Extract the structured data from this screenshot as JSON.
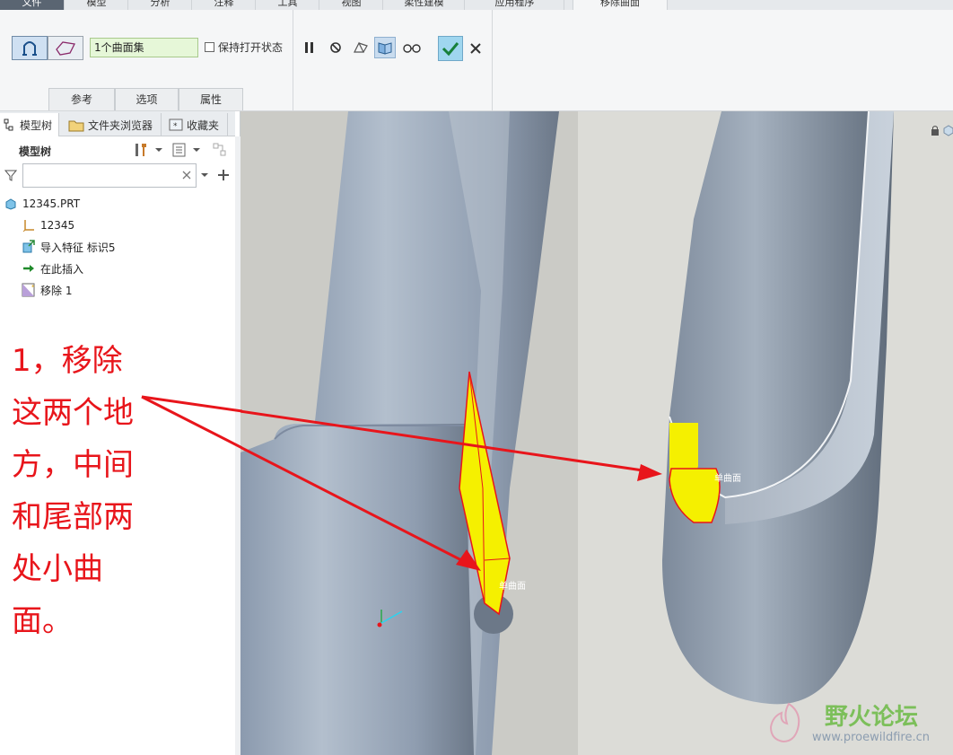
{
  "ribbon": {
    "tabs": [
      "文件",
      "模型",
      "分析",
      "注释",
      "工具",
      "视图",
      "柔性建模",
      "应用程序",
      "移除曲面"
    ],
    "active_tab": "移除曲面"
  },
  "dashboard": {
    "collector_value": "1个曲面集",
    "keep_open_label": "保持打开状态",
    "keep_open_checked": false,
    "tabs": [
      "参考",
      "选项",
      "属性"
    ]
  },
  "navigator": {
    "tabs": [
      "模型树",
      "文件夹浏览器",
      "收藏夹"
    ],
    "tree_title": "模型树",
    "search_placeholder": "",
    "tree_items": [
      {
        "label": "12345.PRT",
        "icon": "part-icon"
      },
      {
        "label": "12345",
        "icon": "csys-icon"
      },
      {
        "label": "导入特征 标识5",
        "icon": "import-feature-icon"
      },
      {
        "label": "在此插入",
        "icon": "insert-here-arrow-icon"
      },
      {
        "label": "移除 1",
        "icon": "remove-surface-feature-icon"
      }
    ]
  },
  "annotation": {
    "lines": [
      "1，移除",
      "这两个地",
      "方，中间",
      "和尾部两",
      "处小曲",
      "面。"
    ],
    "color": "#e8151b"
  },
  "viewport": {
    "surface_labels": [
      "单曲面",
      "单曲面"
    ],
    "highlight_color": "#f5f000",
    "edge_color": "#e8151b"
  },
  "watermark": {
    "title": "野火论坛",
    "url": "www.proewildfire.cn"
  }
}
